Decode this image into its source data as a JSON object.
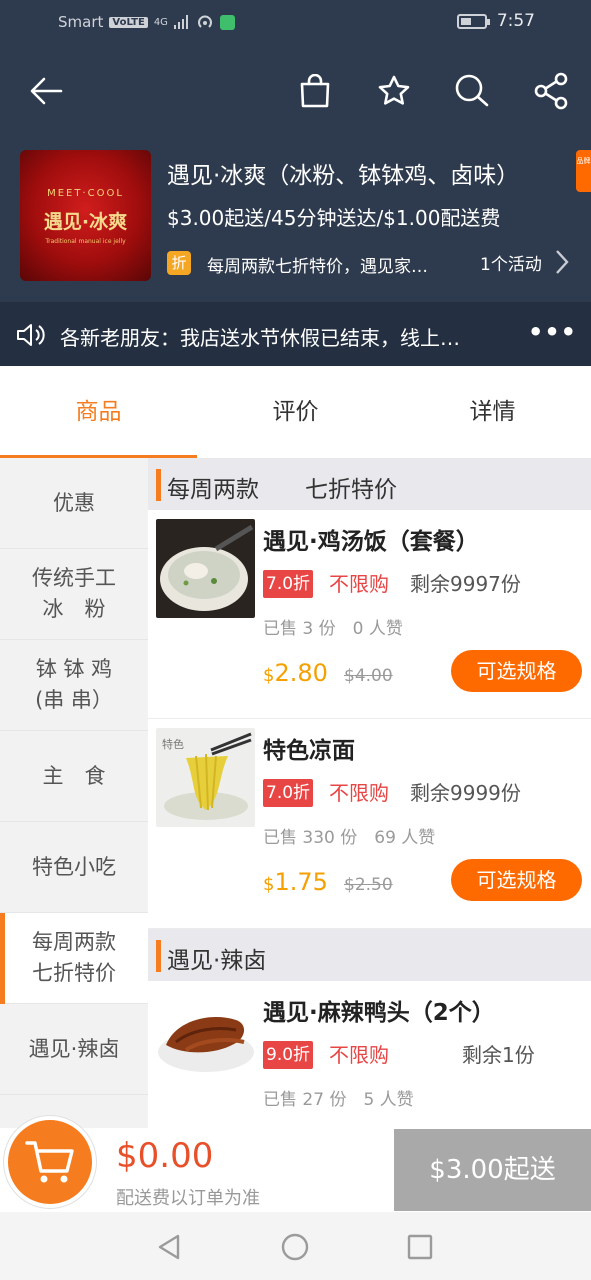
{
  "status_bar": {
    "carrier": "Smart",
    "volte": "VoLTE",
    "network": "4G",
    "time": "7:57"
  },
  "nav": {
    "back_icon": "arrow-left-icon",
    "bag_icon": "shopping-bag-icon",
    "star_icon": "star-icon",
    "search_icon": "search-icon",
    "share_icon": "share-icon"
  },
  "store": {
    "logo_line1": "MEET·COOL",
    "logo_line2": "遇见·冰爽",
    "logo_line3": "Traditional manual ice jelly",
    "name": "遇见·冰爽（冰粉、钵钵鸡、卤味）",
    "delivery_info": "$3.00起送/45分钟送达/$1.00配送费",
    "promo_badge": "折",
    "promo_text": "每周两款七折特价，遇见家…",
    "activity_count": "1个活动",
    "side_tag": "品牌"
  },
  "notice": {
    "text": "各新老朋友：我店送水节休假已结束，线上…",
    "more": "•••"
  },
  "tabs": [
    {
      "label": "商品",
      "active": true
    },
    {
      "label": "评价",
      "active": false
    },
    {
      "label": "详情",
      "active": false
    }
  ],
  "categories": [
    {
      "line1": "优惠",
      "line2": ""
    },
    {
      "line1": "传统手工",
      "line2": "冰　粉"
    },
    {
      "line1": "钵 钵 鸡",
      "line2": "(串 串）"
    },
    {
      "line1": "主　食",
      "line2": ""
    },
    {
      "line1": "特色小吃",
      "line2": ""
    },
    {
      "line1": "每周两款",
      "line2": "七折特价"
    },
    {
      "line1": "遇见·辣卤",
      "line2": ""
    }
  ],
  "sections": {
    "weekly": "每周两款　　七折特价",
    "spicy": "遇见·辣卤"
  },
  "products": [
    {
      "name": "遇见·鸡汤饭（套餐）",
      "discount": "7.0折",
      "limit": "不限购",
      "stock": "剩余9997份",
      "sold": "已售 3 份　0 人赞",
      "currency": "$",
      "price": "2.80",
      "original_price": "$4.00",
      "button": "可选规格"
    },
    {
      "name": "特色凉面",
      "discount": "7.0折",
      "limit": "不限购",
      "stock": "剩余9999份",
      "sold": "已售 330 份　69 人赞",
      "currency": "$",
      "price": "1.75",
      "original_price": "$2.50",
      "button": "可选规格"
    },
    {
      "name": "遇见·麻辣鸭头（2个）",
      "discount": "9.0折",
      "limit": "不限购",
      "stock": "剩余1份",
      "sold": "已售 27 份　5 人赞"
    }
  ],
  "cart": {
    "total": "$0.00",
    "note": "配送费以订单为准",
    "checkout": "$3.00起送"
  },
  "colors": {
    "header_bg": "#2e3a4d",
    "accent": "#f57c1f",
    "discount_red": "#e84545",
    "price_orange": "#f5a000",
    "button_orange": "#ff6a00"
  }
}
